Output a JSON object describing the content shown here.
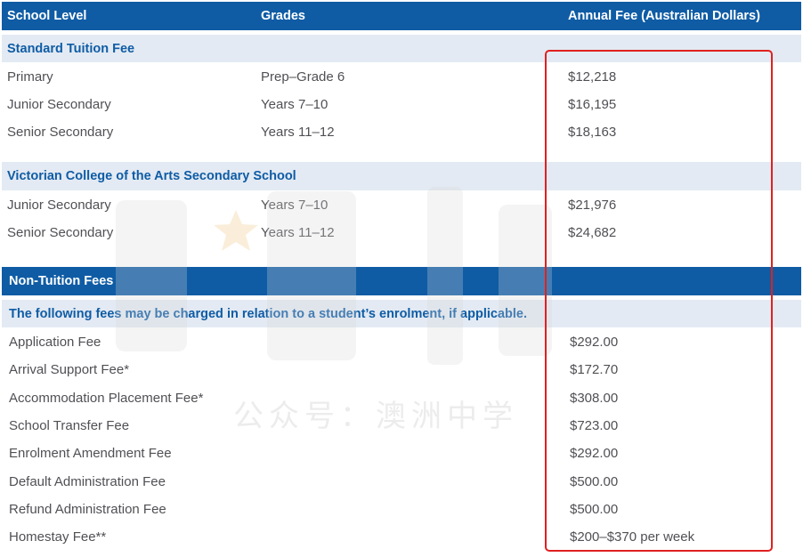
{
  "header": {
    "school_level": "School Level",
    "grades": "Grades",
    "annual_fee": "Annual Fee (Australian Dollars)"
  },
  "standard": {
    "title": "Standard Tuition Fee",
    "rows": [
      {
        "level": "Primary",
        "grades": "Prep–Grade 6",
        "fee": "$12,218"
      },
      {
        "level": "Junior Secondary",
        "grades": "Years 7–10",
        "fee": "$16,195"
      },
      {
        "level": "Senior Secondary",
        "grades": "Years 11–12",
        "fee": "$18,163"
      }
    ]
  },
  "vca": {
    "title": "Victorian College of the Arts Secondary School",
    "rows": [
      {
        "level": "Junior Secondary",
        "grades": "Years 7–10",
        "fee": "$21,976"
      },
      {
        "level": "Senior Secondary",
        "grades": "Years 11–12",
        "fee": "$24,682"
      }
    ]
  },
  "non_tuition": {
    "title": "Non-Tuition Fees",
    "note": "The following fees may be charged in relation to a student’s enrolment, if applicable.",
    "rows": [
      {
        "name": "Application Fee",
        "fee": "$292.00"
      },
      {
        "name": "Arrival Support Fee*",
        "fee": "$172.70"
      },
      {
        "name": "Accommodation Placement Fee*",
        "fee": "$308.00"
      },
      {
        "name": "School Transfer Fee",
        "fee": "$723.00"
      },
      {
        "name": "Enrolment Amendment Fee",
        "fee": "$292.00"
      },
      {
        "name": "Default Administration Fee",
        "fee": "$500.00"
      },
      {
        "name": "Refund Administration Fee",
        "fee": "$500.00"
      },
      {
        "name": "Homestay Fee**",
        "fee": "$200–$370 per week"
      }
    ]
  },
  "watermark": {
    "text": "公众号：澳洲中学"
  },
  "colors": {
    "header_bg": "#0f5ca5",
    "section_bg": "#e3eaf3",
    "highlight": "#e02020"
  }
}
